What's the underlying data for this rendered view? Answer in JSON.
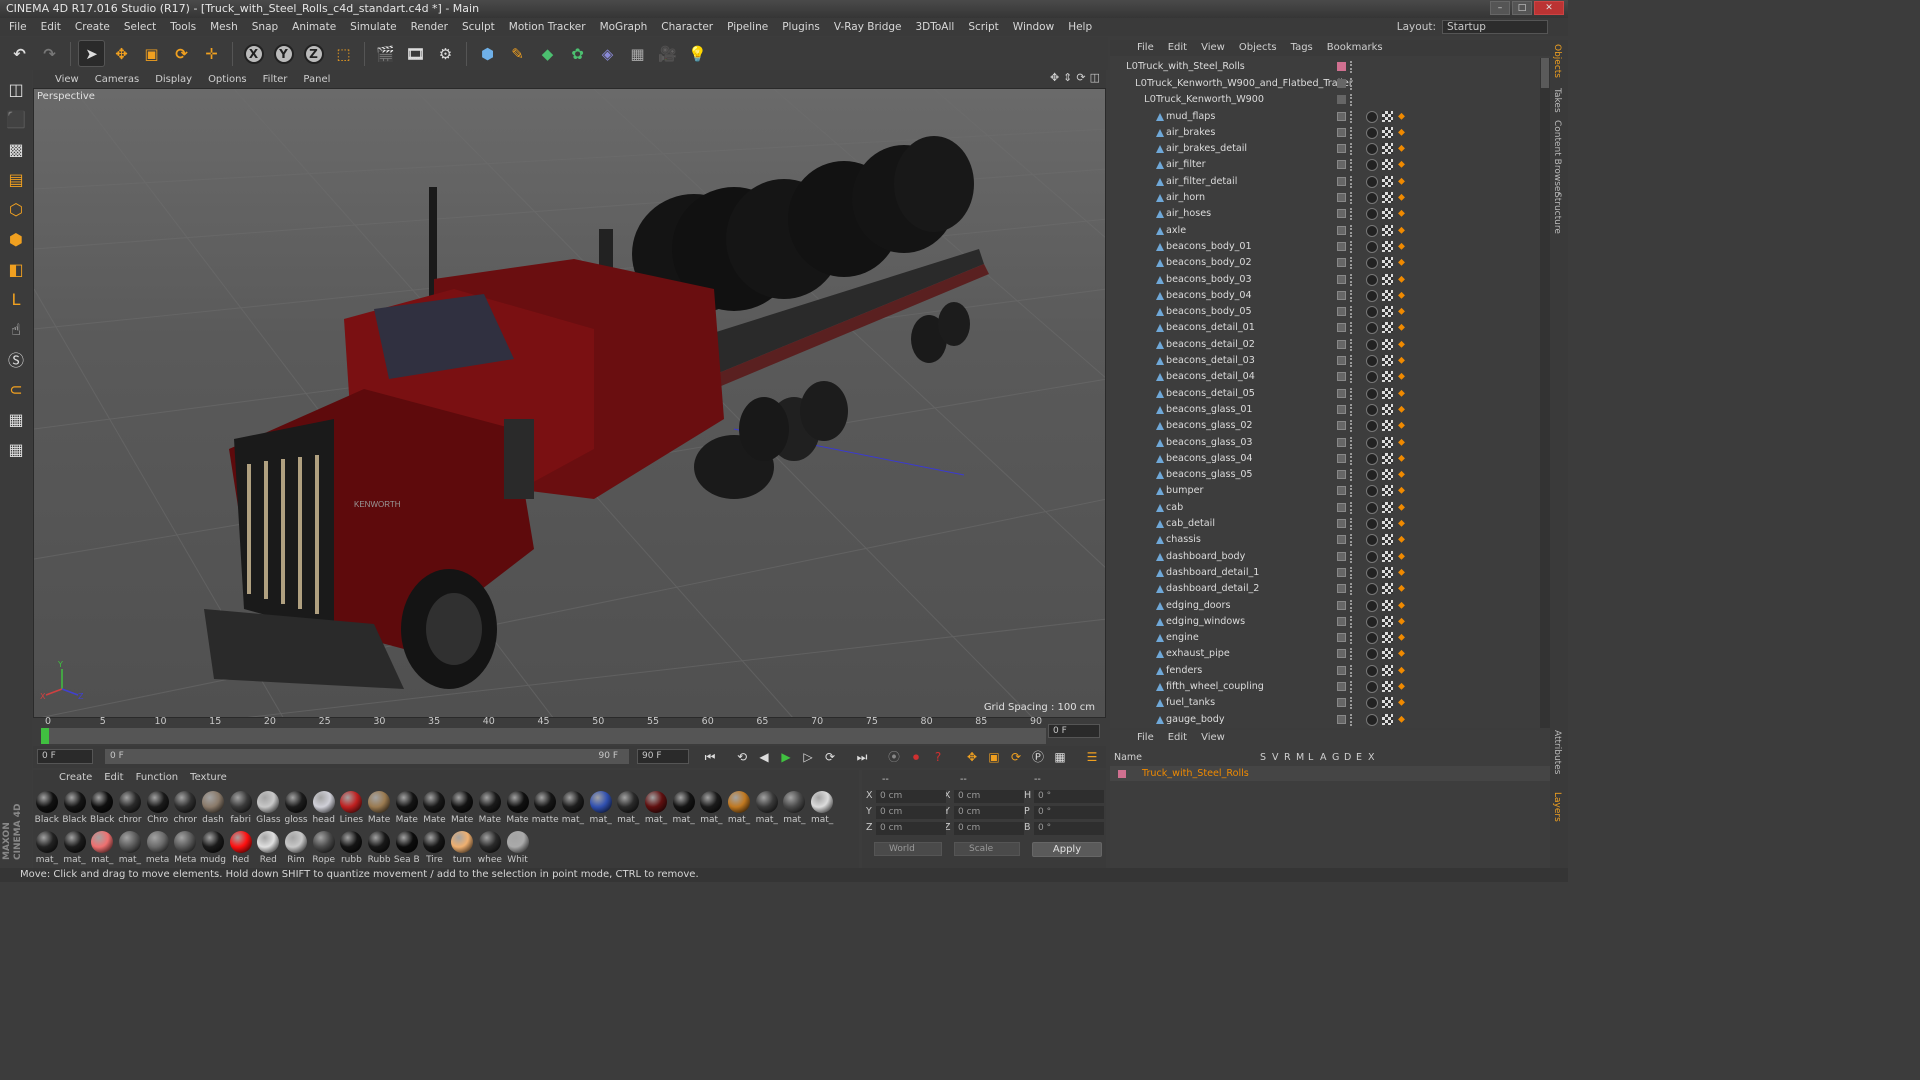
{
  "window": {
    "title": "CINEMA 4D R17.016 Studio (R17) - [Truck_with_Steel_Rolls_c4d_standart.c4d *] - Main"
  },
  "menubar": [
    "File",
    "Edit",
    "Create",
    "Select",
    "Tools",
    "Mesh",
    "Snap",
    "Animate",
    "Simulate",
    "Render",
    "Sculpt",
    "Motion Tracker",
    "MoGraph",
    "Character",
    "Pipeline",
    "Plugins",
    "V-Ray Bridge",
    "3DToAll",
    "Script",
    "Window",
    "Help"
  ],
  "layout": {
    "label": "Layout:",
    "value": "Startup"
  },
  "viewport": {
    "menu": [
      "View",
      "Cameras",
      "Display",
      "Options",
      "Filter",
      "Panel"
    ],
    "label": "Perspective",
    "grid_spacing": "Grid Spacing : 100 cm",
    "axis_y": "Y",
    "axis_x": "X",
    "axis_z": "Z",
    "brand_text": "KENWORTH"
  },
  "timeline": {
    "ticks": [
      "0",
      "5",
      "10",
      "15",
      "20",
      "25",
      "30",
      "35",
      "40",
      "45",
      "50",
      "55",
      "60",
      "65",
      "70",
      "75",
      "80",
      "85",
      "90"
    ],
    "end_frame": "0 F",
    "field_start": "0 F",
    "field_range_start": "0 F",
    "field_range_end": "90 F",
    "field_end": "90 F"
  },
  "materials": {
    "menu": [
      "Create",
      "Edit",
      "Function",
      "Texture"
    ],
    "items": [
      {
        "label": "Black",
        "color": "#111111"
      },
      {
        "label": "Black",
        "color": "#151515"
      },
      {
        "label": "Black",
        "color": "#0e0e0e"
      },
      {
        "label": "chror",
        "color": "#2a2a2a"
      },
      {
        "label": "Chro",
        "color": "#1a1a1a"
      },
      {
        "label": "chror",
        "color": "#303030"
      },
      {
        "label": "dash",
        "color": "#8a7a6a"
      },
      {
        "label": "fabri",
        "color": "#3a3a3a"
      },
      {
        "label": "Glass",
        "color": "#c8c8c8"
      },
      {
        "label": "gloss",
        "color": "#1c1c1c"
      },
      {
        "label": "head",
        "color": "#d0d0d8"
      },
      {
        "label": "Lines",
        "color": "#c02020"
      },
      {
        "label": "Mate",
        "color": "#9a7a50"
      },
      {
        "label": "Mate",
        "color": "#141414"
      },
      {
        "label": "Mate",
        "color": "#181818"
      },
      {
        "label": "Mate",
        "color": "#121212"
      },
      {
        "label": "Mate",
        "color": "#1a1a1a"
      },
      {
        "label": "Mate",
        "color": "#101010"
      },
      {
        "label": "matte",
        "color": "#161616"
      },
      {
        "label": "mat_",
        "color": "#1d1d1d"
      },
      {
        "label": "mat_",
        "color": "#3050b0"
      },
      {
        "label": "mat_",
        "color": "#2a2a2a"
      },
      {
        "label": "mat_",
        "color": "#601010"
      },
      {
        "label": "mat_",
        "color": "#141414"
      },
      {
        "label": "mat_",
        "color": "#1a1a1a"
      },
      {
        "label": "mat_",
        "color": "#c07820"
      },
      {
        "label": "mat_",
        "color": "#3a3a3a"
      },
      {
        "label": "mat_",
        "color": "#4a4a4a"
      },
      {
        "label": "mat_",
        "color": "#dcdcdc"
      },
      {
        "label": "mat_",
        "color": "#222222"
      },
      {
        "label": "mat_",
        "color": "#1c1c1c"
      },
      {
        "label": "mat_",
        "color": "#f07070"
      },
      {
        "label": "mat_",
        "color": "#5a5a5a"
      },
      {
        "label": "meta",
        "color": "#6a6a6a"
      },
      {
        "label": "Meta",
        "color": "#5a5a5a"
      },
      {
        "label": "mudg",
        "color": "#1a1a1a"
      },
      {
        "label": "Red",
        "color": "#ff1010"
      },
      {
        "label": "Red",
        "color": "#e0e0e0"
      },
      {
        "label": "Rim",
        "color": "#c8c8c8"
      },
      {
        "label": "Rope",
        "color": "#4a4a4a"
      },
      {
        "label": "rubb",
        "color": "#141414"
      },
      {
        "label": "Rubb",
        "color": "#181818"
      },
      {
        "label": "Sea B",
        "color": "#0c0c0c"
      },
      {
        "label": "Tire",
        "color": "#161616"
      },
      {
        "label": "turn",
        "color": "#f0b070"
      },
      {
        "label": "whee",
        "color": "#2a2a2a"
      },
      {
        "label": "Whit",
        "color": "#aaaaaa"
      }
    ]
  },
  "coords": {
    "header": [
      "--",
      "--",
      "--"
    ],
    "rows": [
      {
        "a1": "X",
        "v1": "0 cm",
        "a2": "X",
        "v2": "0 cm",
        "a3": "H",
        "v3": "0 °"
      },
      {
        "a1": "Y",
        "v1": "0 cm",
        "a2": "Y",
        "v2": "0 cm",
        "a3": "P",
        "v3": "0 °"
      },
      {
        "a1": "Z",
        "v1": "0 cm",
        "a2": "Z",
        "v2": "0 cm",
        "a3": "B",
        "v3": "0 °"
      }
    ],
    "mode1": "World",
    "mode2": "Scale",
    "apply": "Apply"
  },
  "object_manager": {
    "menu": [
      "File",
      "Edit",
      "View",
      "Objects",
      "Tags",
      "Bookmarks"
    ],
    "root": "Truck_with_Steel_Rolls",
    "group": "Truck_Kenworth_W900_and_Flatbed_Trailer",
    "sub": "Truck_Kenworth_W900",
    "objects": [
      "mud_flaps",
      "air_brakes",
      "air_brakes_detail",
      "air_filter",
      "air_filter_detail",
      "air_horn",
      "air_hoses",
      "axle",
      "beacons_body_01",
      "beacons_body_02",
      "beacons_body_03",
      "beacons_body_04",
      "beacons_body_05",
      "beacons_detail_01",
      "beacons_detail_02",
      "beacons_detail_03",
      "beacons_detail_04",
      "beacons_detail_05",
      "beacons_glass_01",
      "beacons_glass_02",
      "beacons_glass_03",
      "beacons_glass_04",
      "beacons_glass_05",
      "bumper",
      "cab",
      "cab_detail",
      "chassis",
      "dashboard_body",
      "dashboard_detail_1",
      "dashboard_detail_2",
      "edging_doors",
      "edging_windows",
      "engine",
      "exhaust_pipe",
      "fenders",
      "fifth_wheel_coupling",
      "fuel_tanks",
      "gauge_body"
    ]
  },
  "right_tabs": [
    "Objects",
    "Takes",
    "Content Browser",
    "Structure",
    "Attributes",
    "Layers"
  ],
  "attributes_manager": {
    "menu": [
      "File",
      "Edit",
      "View"
    ],
    "header": [
      "Name",
      "S",
      "V",
      "R",
      "M",
      "L",
      "A",
      "G",
      "D",
      "E",
      "X"
    ],
    "row": "Truck_with_Steel_Rolls"
  },
  "status": "Move: Click and drag to move elements. Hold down SHIFT to quantize movement / add to the selection in point mode, CTRL to remove.",
  "brand": {
    "maxon": "MAXON",
    "cinema": "CINEMA 4D"
  }
}
